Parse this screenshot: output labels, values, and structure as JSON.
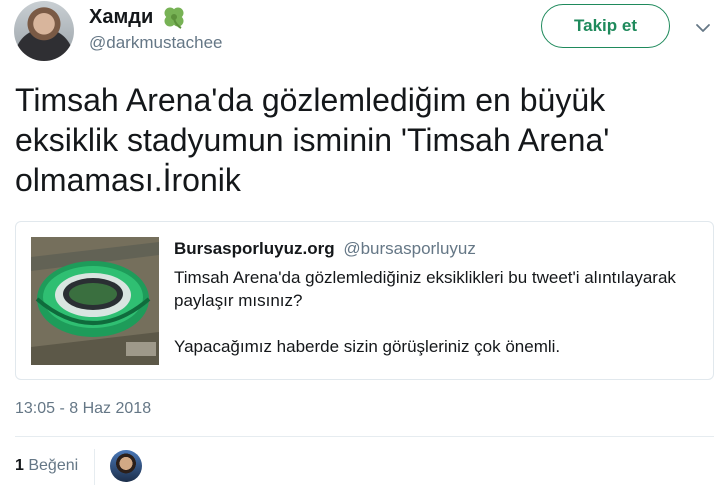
{
  "author": {
    "name": "Хамди",
    "badge_icon": "four-leaf-clover-icon",
    "handle": "@darkmustachee"
  },
  "follow_button": {
    "label": "Takip et",
    "color": "#1f8a5c"
  },
  "more_icon": "chevron-down-icon",
  "tweet": {
    "text": "Timsah Arena'da gözlemlediğim en büyük\neksiklik stadyumun isminin 'Timsah Arena'\nolmaması.İronik"
  },
  "quoted_tweet": {
    "name": "Bursasporluyuz.org",
    "handle": "@bursasporluyuz",
    "text": "Timsah Arena'da gözlemlediğiniz eksiklikleri bu tweet'i alıntılayarak\npaylaşır mısınız?\n\nYapacağımız haberde sizin görüşleriniz çok önemli."
  },
  "timestamp": "13:05 - 8 Haz 2018",
  "likes": {
    "count": "1",
    "label": "Beğeni"
  }
}
